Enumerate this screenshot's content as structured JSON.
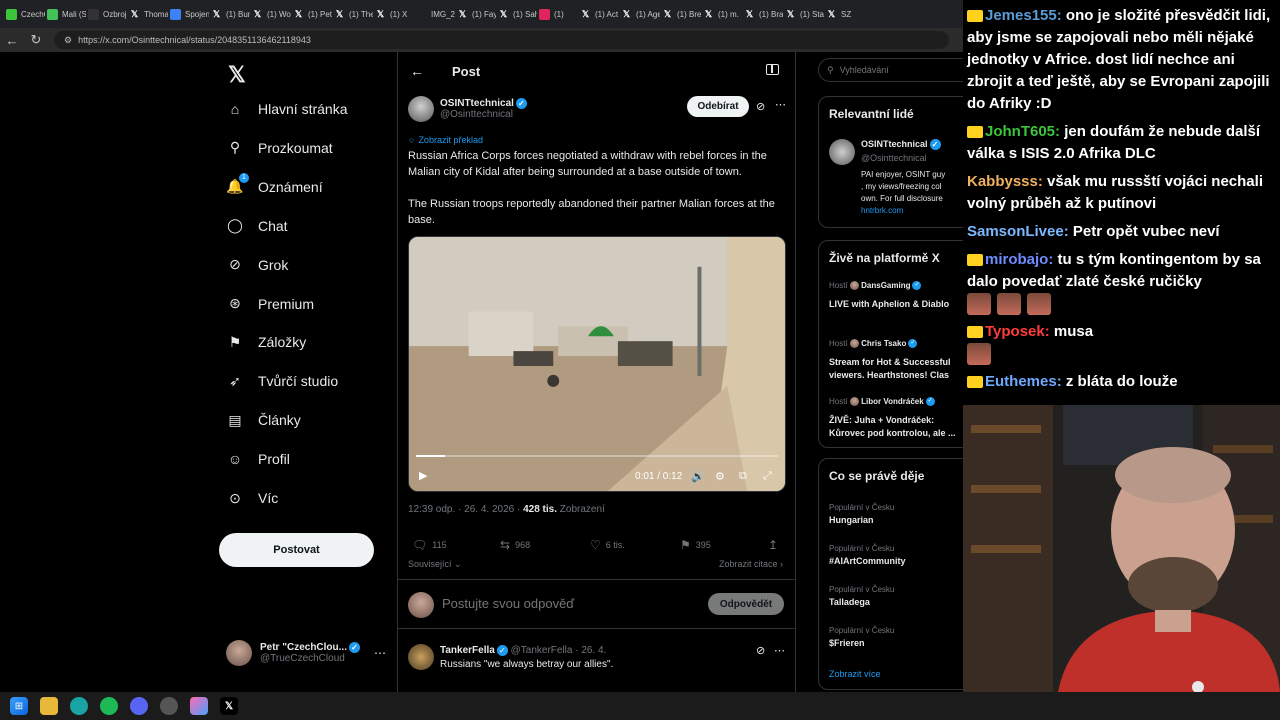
{
  "browser": {
    "tabs": [
      {
        "label": "CzechC",
        "icon": "k-icon",
        "color": "#3cc43c"
      },
      {
        "label": "Mali (S",
        "icon": "green-icon",
        "color": "#44c25a"
      },
      {
        "label": "Ozbroj",
        "icon": "szj-icon",
        "color": "#333333"
      },
      {
        "label": "Thoma",
        "icon": "x-icon",
        "color": "#202124"
      },
      {
        "label": "Spojen",
        "icon": "doc-icon",
        "color": "#3b82f6"
      },
      {
        "label": "(1) Bun",
        "icon": "x-icon",
        "color": "#202124"
      },
      {
        "label": "(1) Wo",
        "icon": "x-icon",
        "color": "#202124"
      },
      {
        "label": "(1) Petr",
        "icon": "x-icon",
        "color": "#202124"
      },
      {
        "label": "(1) The",
        "icon": "x-icon",
        "color": "#202124"
      },
      {
        "label": "(1) X",
        "icon": "x-icon",
        "color": "#202124"
      },
      {
        "label": "IMG_24",
        "icon": "globe-icon",
        "color": "#202124"
      },
      {
        "label": "(1) Fay",
        "icon": "x-icon",
        "color": "#202124"
      },
      {
        "label": "(1) Sah",
        "icon": "x-icon",
        "color": "#202124"
      },
      {
        "label": "(1)",
        "icon": "red-icon",
        "color": "#e0245e"
      },
      {
        "label": "(1) Act",
        "icon": "x-icon",
        "color": "#202124"
      },
      {
        "label": "(1) Age",
        "icon": "x-icon",
        "color": "#202124"
      },
      {
        "label": "(1) Bre",
        "icon": "x-icon",
        "color": "#202124"
      },
      {
        "label": "(1) m.",
        "icon": "x-icon",
        "color": "#202124"
      },
      {
        "label": "(1) Bra",
        "icon": "x-icon",
        "color": "#202124"
      },
      {
        "label": "(1) Stat",
        "icon": "x-icon",
        "color": "#202124"
      },
      {
        "label": "SZ",
        "icon": "x-icon",
        "color": "#202124"
      }
    ],
    "url": "https://x.com/Osinttechnical/status/2048351136462118943"
  },
  "nav": {
    "items": [
      {
        "label": "Hlavní stránka",
        "icon": "home-icon"
      },
      {
        "label": "Prozkoumat",
        "icon": "search-icon"
      },
      {
        "label": "Oznámení",
        "icon": "bell-icon",
        "badge": "1"
      },
      {
        "label": "Chat",
        "icon": "chat-icon"
      },
      {
        "label": "Grok",
        "icon": "grok-icon"
      },
      {
        "label": "Premium",
        "icon": "premium-icon"
      },
      {
        "label": "Záložky",
        "icon": "bookmark-icon"
      },
      {
        "label": "Tvůrčí studio",
        "icon": "rocket-icon"
      },
      {
        "label": "Články",
        "icon": "article-icon"
      },
      {
        "label": "Profil",
        "icon": "profile-icon"
      },
      {
        "label": "Víc",
        "icon": "more-icon"
      }
    ],
    "post_label": "Postovat",
    "account": {
      "name": "Petr \"CzechClou...",
      "handle": "@TrueCzechCloud"
    }
  },
  "post": {
    "header_title": "Post",
    "author_name": "OSINTtechnical",
    "author_handle": "@Osinttechnical",
    "follow_label": "Odebírat",
    "translate_label": "Zobrazit překlad",
    "text1": "Russian Africa Corps forces negotiated a withdraw with rebel forces in the Malian city of Kidal after being surrounded at a base outside of town.",
    "text2": "The Russian troops reportedly abandoned their partner Malian forces at the base.",
    "video": {
      "time": "0:01 / 0:12",
      "progress": 0.08
    },
    "timestamp": "12:39 odp. · 26. 4. 2026 · ",
    "views_count": "428 tis.",
    "views_label": "Zobrazení",
    "replies": "115",
    "reposts": "968",
    "likes": "6 tis.",
    "bookmarks": "395",
    "related_label": "Související",
    "quotes_label": "Zobrazit citace",
    "reply_placeholder": "Postujte svou odpověď",
    "reply_button": "Odpovědět",
    "reply1": {
      "name": "TankerFella",
      "handle": "@TankerFella · 26. 4.",
      "text": "Russians \"we always betray our allies\"."
    }
  },
  "sidebar": {
    "search_placeholder": "Vyhledávání",
    "relevant_title": "Relevantní lidé",
    "relevant_name": "OSINTtechnical",
    "relevant_handle": "@Osinttechnical",
    "relevant_bio1": "PAI enjoyer, OSINT guy",
    "relevant_bio2": ", my views/freezing col",
    "relevant_bio3": "own. For full disclosure",
    "relevant_link": "hntrbrk.com",
    "live_title": "Živě na platformě X",
    "live": [
      {
        "host_label": "Hostí",
        "host": "DansGaming",
        "title": "LIVE with Aphelion & Diablo"
      },
      {
        "host_label": "Hostí",
        "host": "Chris Tsako",
        "title": "Stream for Hot & Successful viewers. Hearthstones! Clas"
      },
      {
        "host_label": "Hostí",
        "host": "Libor Vondráček",
        "title": "ŽIVĚ: Juha + Vondráček: Kůrovec pod kontrolou, ale ..."
      }
    ],
    "trends_title": "Co se právě děje",
    "trends": [
      {
        "context": "Populární v Česku",
        "name": "Hungarian"
      },
      {
        "context": "Populární v Česku",
        "name": "#AIArtCommunity"
      },
      {
        "context": "Populární v Česku",
        "name": "Talladega"
      },
      {
        "context": "Populární v Česku",
        "name": "$Frieren"
      }
    ],
    "show_more": "Zobrazit více"
  },
  "chat": [
    {
      "user": "Jemes155",
      "color": "#5b9bd5",
      "text": "ono je složité přesvědčit lidi, aby jsme se zapojovali nebo měli nějaké jednotky v Africe. dost lidí nechce ani zbrojit a teď ještě, aby se Evropani zapojili do Afriky :D",
      "badge": true
    },
    {
      "user": "JohnT605",
      "color": "#3cc43c",
      "text": "jen doufám že nebude další válka s ISIS 2.0 Afrika DLC",
      "badge": true
    },
    {
      "user": "Kabbysss",
      "color": "#f0b060",
      "text": "však mu russští vojáci nechali volný průběh až k putínovi",
      "badge": false
    },
    {
      "user": "SamsonLivee",
      "color": "#7ab8ff",
      "text": "Petr opět vubec neví",
      "badge": false
    },
    {
      "user": "mirobajo",
      "color": "#6f8cff",
      "text": "tu s tým kontingentom by sa dalo povedať zlaté české ručičky",
      "badge": true,
      "emotes": 3
    },
    {
      "user": "Typosek",
      "color": "#ff3c3c",
      "text": "musa",
      "badge": true,
      "emotes": 1
    },
    {
      "user": "Euthemes",
      "color": "#6fa8ff",
      "text": "z bláta do louže",
      "badge": true
    }
  ]
}
